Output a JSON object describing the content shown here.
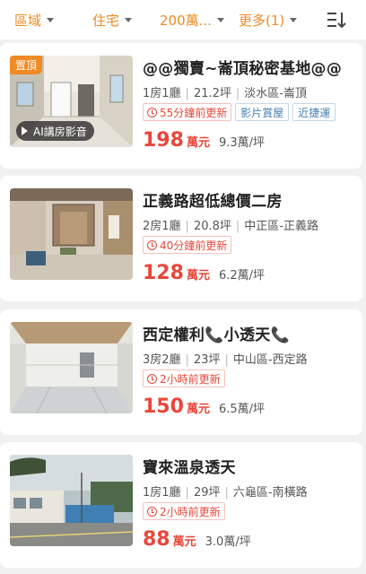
{
  "filters": [
    {
      "label": "區域"
    },
    {
      "label": "住宅"
    },
    {
      "label": "200萬..."
    },
    {
      "label": "更多(1)"
    }
  ],
  "colors": {
    "accent": "#f08a24",
    "price": "#e8473a",
    "tag_blue": "#4a7fb0"
  },
  "listings": [
    {
      "badge": "置頂",
      "ai_label": "AI講房影音",
      "title": "@@獨賣~崙頂秘密基地@@",
      "layout": "1房1廳",
      "size": "21.2坪",
      "location": "淡水區-崙頂",
      "updated": "55分鐘前更新",
      "tags": [
        "影片賞屋",
        "近捷運"
      ],
      "price": "198",
      "price_unit": "萬元",
      "unit_price": "9.3萬/坪"
    },
    {
      "title": "正義路超低總價二房",
      "layout": "2房1廳",
      "size": "20.8坪",
      "location": "中正區-正義路",
      "updated": "40分鐘前更新",
      "price": "128",
      "price_unit": "萬元",
      "unit_price": "6.2萬/坪"
    },
    {
      "title": "西定權利📞小透天📞",
      "layout": "3房2廳",
      "size": "23坪",
      "location": "中山區-西定路",
      "updated": "2小時前更新",
      "price": "150",
      "price_unit": "萬元",
      "unit_price": "6.5萬/坪"
    },
    {
      "title": "寶來溫泉透天",
      "layout": "1房1廳",
      "size": "29坪",
      "location": "六龜區-南橫路",
      "updated": "2小時前更新",
      "price": "88",
      "price_unit": "萬元",
      "unit_price": "3.0萬/坪"
    }
  ]
}
